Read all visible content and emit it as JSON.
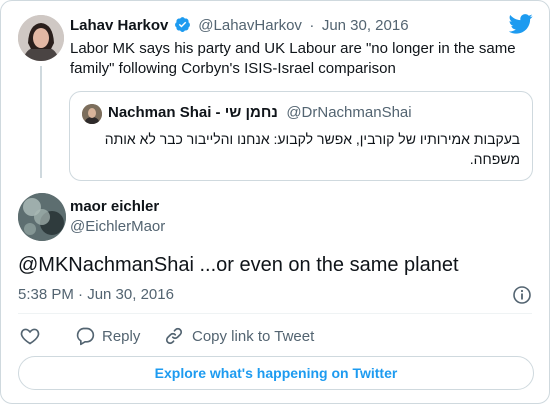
{
  "parent_tweet": {
    "author_name": "Lahav Harkov",
    "handle": "@LahavHarkov",
    "separator": "·",
    "date": "Jun 30, 2016",
    "text": "Labor MK says his party and UK Labour are \"no longer in the same family\" following Corbyn's ISIS-Israel comparison",
    "verified_icon": "verified-badge-icon"
  },
  "quoted_tweet": {
    "author_name": "Nachman Shai - נחמן שי",
    "handle": "@DrNachmanShai",
    "text_line1": "בעקבות אמירותיו של קורבין, אפשר לקבוע: אנחנו והלייבור כבר לא אותה",
    "text_line2": "משפחה."
  },
  "main_tweet": {
    "author_name": "maor eichler",
    "handle": "@EichlerMaor",
    "text": "@MKNachmanShai ...or even on the same planet",
    "timestamp": "5:38 PM · Jun 30, 2016"
  },
  "actions": {
    "like_icon": "heart-icon",
    "reply_label": "Reply",
    "copy_label": "Copy link to Tweet"
  },
  "explore_label": "Explore what's happening on Twitter",
  "colors": {
    "brand": "#1d9bf0",
    "text": "#0f1419",
    "secondary": "#536471",
    "border": "#cfd9de"
  }
}
